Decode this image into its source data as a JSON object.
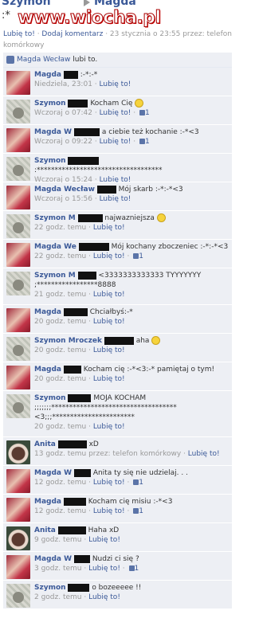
{
  "header": {
    "name1": "Szymon",
    "name2": "Magda",
    "status": ":*",
    "watermark": "www.wiocha.pl",
    "actions": {
      "like": "Lubię to!",
      "comment": "Dodaj komentarz",
      "timestamp": "23 stycznia o 23:55 przez: telefon komórkowy"
    }
  },
  "likes_bar": {
    "name": "Magda Wecław",
    "suffix": "lubi to."
  },
  "comments": [
    {
      "author": "Magda",
      "text": ":-*:-*",
      "time": "Niedziela, 23:01",
      "like": "Lubię to!",
      "likes": "",
      "avatar": "red",
      "h": 36
    },
    {
      "author": "Szymon",
      "text": "Kocham Cię",
      "time": "Wczoraj o 07:42",
      "like": "Lubię to!",
      "likes": "1",
      "avatar": "grey",
      "smiley": true,
      "h": 36
    },
    {
      "author": "Magda W",
      "text": "a ciebie też kochanie :-*<3",
      "time": "Wczoraj o 09:22",
      "like": "Lubię to!",
      "likes": "1",
      "avatar": "red",
      "h": 36
    },
    {
      "author": "Szymon",
      "text": ":***********************************",
      "time": "Wczoraj o 15:24",
      "like": "Lubię to!",
      "likes": "",
      "avatar": "grey",
      "h": 36
    },
    {
      "author": "Magda Wecław",
      "text": "Mój skarb :-*:-*<3",
      "time": "Wczoraj o 15:56",
      "like": "Lubię to!",
      "likes": "",
      "avatar": "red",
      "h": 36
    },
    {
      "author": "Szymon M",
      "text": "najwazniejsza",
      "time": "22 godz. temu",
      "like": "Lubię to!",
      "likes": "",
      "avatar": "grey",
      "smiley": true,
      "h": 36
    },
    {
      "author": "Magda We",
      "text": "Mój kochany zboczeniec :-*:-*<3",
      "time": "22 godz. temu",
      "like": "Lubię to!",
      "likes": "1",
      "avatar": "red",
      "h": 36
    },
    {
      "author": "Szymon M",
      "text": "<3333333333333 TYYYYYYY ;*****************8888",
      "time": "21 godz. temu",
      "like": "Lubię to!",
      "likes": "",
      "avatar": "grey",
      "h": 46
    },
    {
      "author": "Magda",
      "text": "Chciałbyś:-*",
      "time": "20 godz. temu",
      "like": "Lubię to!",
      "likes": "",
      "avatar": "red",
      "h": 36
    },
    {
      "author": "Szymon Mroczek",
      "text": "aha",
      "time": "20 godz. temu",
      "like": "Lubię to!",
      "likes": "",
      "avatar": "grey",
      "smiley": true,
      "h": 36
    },
    {
      "author": "Magda",
      "text": "Kocham cię :-*<3:-* pamiętaj o tym!",
      "time": "20 godz. temu",
      "like": "Lubię to!",
      "likes": "",
      "avatar": "red",
      "h": 36
    },
    {
      "author": "Szymon",
      "text": "MOJA KOCHAM ;;;;;;;*********************************** <3;;;***********************",
      "time": "20 godz. temu",
      "like": "Lubię to!",
      "likes": "",
      "avatar": "grey",
      "h": 58
    },
    {
      "author": "Anita",
      "text": "xD",
      "time": "13 godz. temu przez: telefon komórkowy",
      "like": "Lubię to!",
      "likes": "",
      "avatar": "anita",
      "h": 36
    },
    {
      "author": "Magda W",
      "text": "Anita ty się nie udzielaj. . .",
      "time": "12 godz. temu",
      "like": "Lubię to!",
      "likes": "1",
      "avatar": "red",
      "h": 36
    },
    {
      "author": "Magda",
      "text": "Kocham cię misiu :-*<3",
      "time": "12 godz. temu",
      "like": "Lubię to!",
      "likes": "1",
      "avatar": "red",
      "h": 36
    },
    {
      "author": "Anita",
      "text": "Haha xD",
      "time": "9 godz. temu",
      "like": "Lubię to!",
      "likes": "",
      "avatar": "anita",
      "h": 36
    },
    {
      "author": "Magda W",
      "text": "Nudzi ci się ?",
      "time": "3 godz. temu",
      "like": "Lubię to!",
      "likes": "1",
      "avatar": "red",
      "h": 36
    },
    {
      "author": "Szymon",
      "text": "o bozeeeee !!",
      "time": "2 godz. temu",
      "like": "Lubię to!",
      "likes": "",
      "avatar": "grey",
      "h": 36
    }
  ]
}
